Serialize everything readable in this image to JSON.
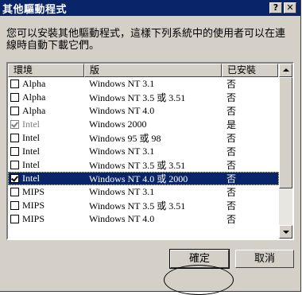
{
  "dialog": {
    "title": "其他驅動程式",
    "help_label": "?",
    "close_label": "✕",
    "description": "您可以安裝其他驅動程式，這樣下列系統中的使用者可以在連線時自動下載它們。"
  },
  "table": {
    "headers": [
      "環境",
      "版",
      "已安裝"
    ],
    "rows": [
      {
        "env": "Alpha",
        "version": "Windows NT 3.1",
        "installed": "否",
        "checked": false,
        "disabled": false
      },
      {
        "env": "Alpha",
        "version": "Windows NT 3.5 或 3.51",
        "installed": "否",
        "checked": false,
        "disabled": false
      },
      {
        "env": "Alpha",
        "version": "Windows NT 4.0",
        "installed": "否",
        "checked": false,
        "disabled": false
      },
      {
        "env": "Intel",
        "version": "Windows 2000",
        "installed": "是",
        "checked": true,
        "disabled": true
      },
      {
        "env": "Intel",
        "version": "Windows 95 或 98",
        "installed": "否",
        "checked": false,
        "disabled": false
      },
      {
        "env": "Intel",
        "version": "Windows NT 3.1",
        "installed": "否",
        "checked": false,
        "disabled": false
      },
      {
        "env": "Intel",
        "version": "Windows NT 3.5 或 3.51",
        "installed": "否",
        "checked": false,
        "disabled": false
      },
      {
        "env": "Intel",
        "version": "Windows NT 4.0 或 2000",
        "installed": "否",
        "checked": true,
        "disabled": false,
        "selected": true
      },
      {
        "env": "MIPS",
        "version": "Windows NT 3.1",
        "installed": "否",
        "checked": false,
        "disabled": false
      },
      {
        "env": "MIPS",
        "version": "Windows NT 3.5 或 3.51",
        "installed": "否",
        "checked": false,
        "disabled": false
      },
      {
        "env": "MIPS",
        "version": "Windows NT 4.0",
        "installed": "否",
        "checked": false,
        "disabled": false
      }
    ]
  },
  "buttons": {
    "ok": "確定",
    "cancel": "取消"
  },
  "colors": {
    "title_bar": "#0a246a",
    "selection": "#0a246a",
    "face": "#d4d0c8"
  }
}
